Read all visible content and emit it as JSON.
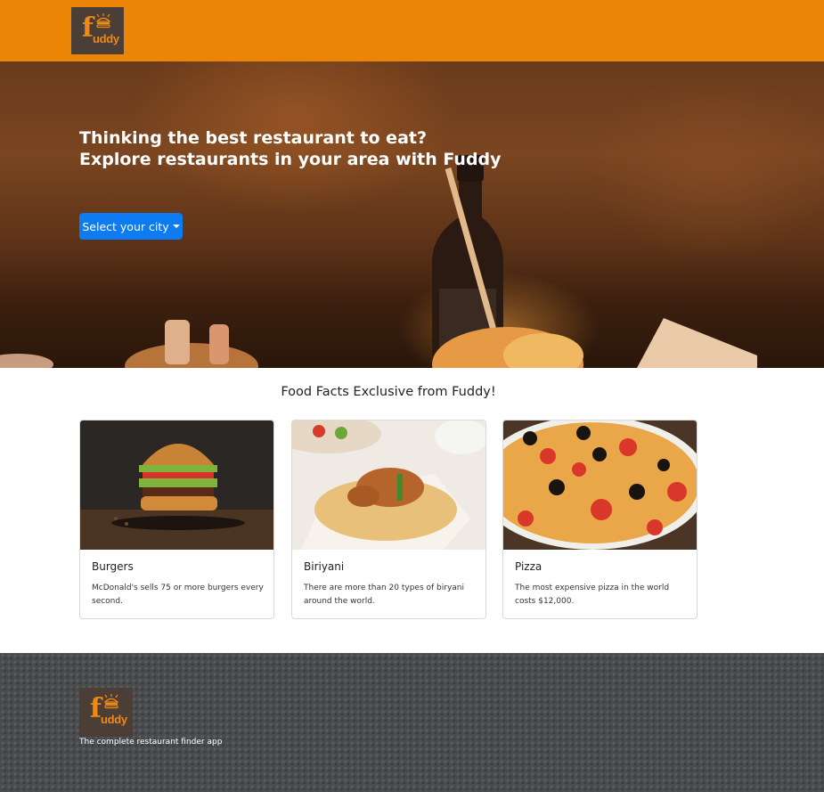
{
  "header": {
    "logo": {
      "letter": "f",
      "text": "uddy",
      "icon": "burger-icon"
    }
  },
  "hero": {
    "line1": "Thinking the best restaurant to eat?",
    "line2": "Explore restaurants in your area with Fuddy",
    "city_button": "Select your city"
  },
  "facts": {
    "title": "Food Facts Exclusive from Fuddy!",
    "cards": [
      {
        "title": "Burgers",
        "text": "McDonald's sells 75 or more burgers every second."
      },
      {
        "title": "Biriyani",
        "text": "There are more than 20 types of biryani around the world."
      },
      {
        "title": "Pizza",
        "text": "The most expensive pizza in the world costs $12,000."
      }
    ]
  },
  "footer": {
    "logo": {
      "letter": "f",
      "text": "uddy",
      "icon": "burger-icon"
    },
    "tagline": "The complete restaurant finder app"
  },
  "colors": {
    "brand_orange": "#ec8406",
    "button_blue": "#0d7bf2",
    "footer_gray": "#4a4b4d"
  }
}
